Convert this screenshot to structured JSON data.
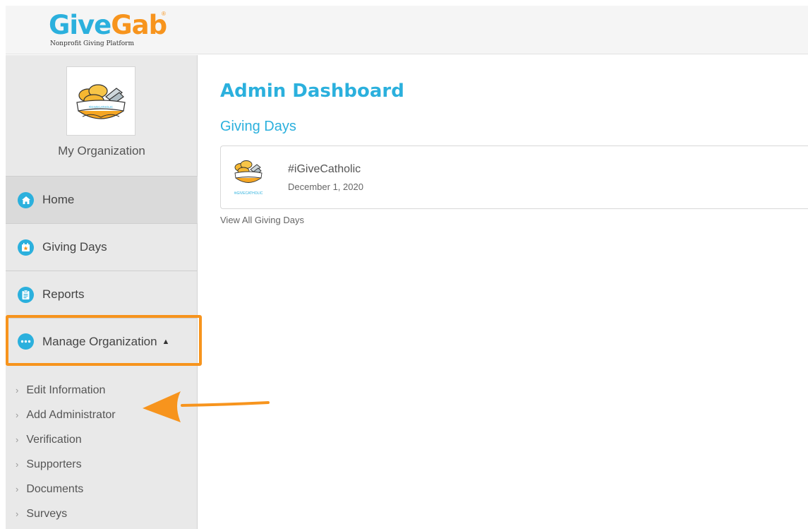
{
  "brand": {
    "logo_give": "Give",
    "logo_gab": "Gab",
    "registered_mark": "®",
    "tagline": "Nonprofit Giving Platform",
    "primary_color": "#2bb0dd",
    "accent_color": "#f7941d"
  },
  "sidebar": {
    "org_logo_text": "#iGIVECATHOLIC",
    "org_name": "My Organization",
    "nav": [
      {
        "label": "Home",
        "icon": "home-icon"
      },
      {
        "label": "Giving Days",
        "icon": "calendar-star-icon"
      },
      {
        "label": "Reports",
        "icon": "clipboard-icon"
      },
      {
        "label": "Manage Organization",
        "icon": "more-dots-icon",
        "caret": "▲"
      }
    ],
    "sub_items": [
      {
        "label": "Edit Information"
      },
      {
        "label": "Add Administrator"
      },
      {
        "label": "Verification"
      },
      {
        "label": "Supporters"
      },
      {
        "label": "Documents"
      },
      {
        "label": "Surveys"
      }
    ],
    "chevron": "›"
  },
  "main": {
    "page_title": "Admin Dashboard",
    "section_title": "Giving Days",
    "giving_day": {
      "logo_text": "#iGIVECATHOLIC",
      "name": "#iGiveCatholic",
      "date": "December 1, 2020"
    },
    "view_all_link": "View All Giving Days"
  }
}
